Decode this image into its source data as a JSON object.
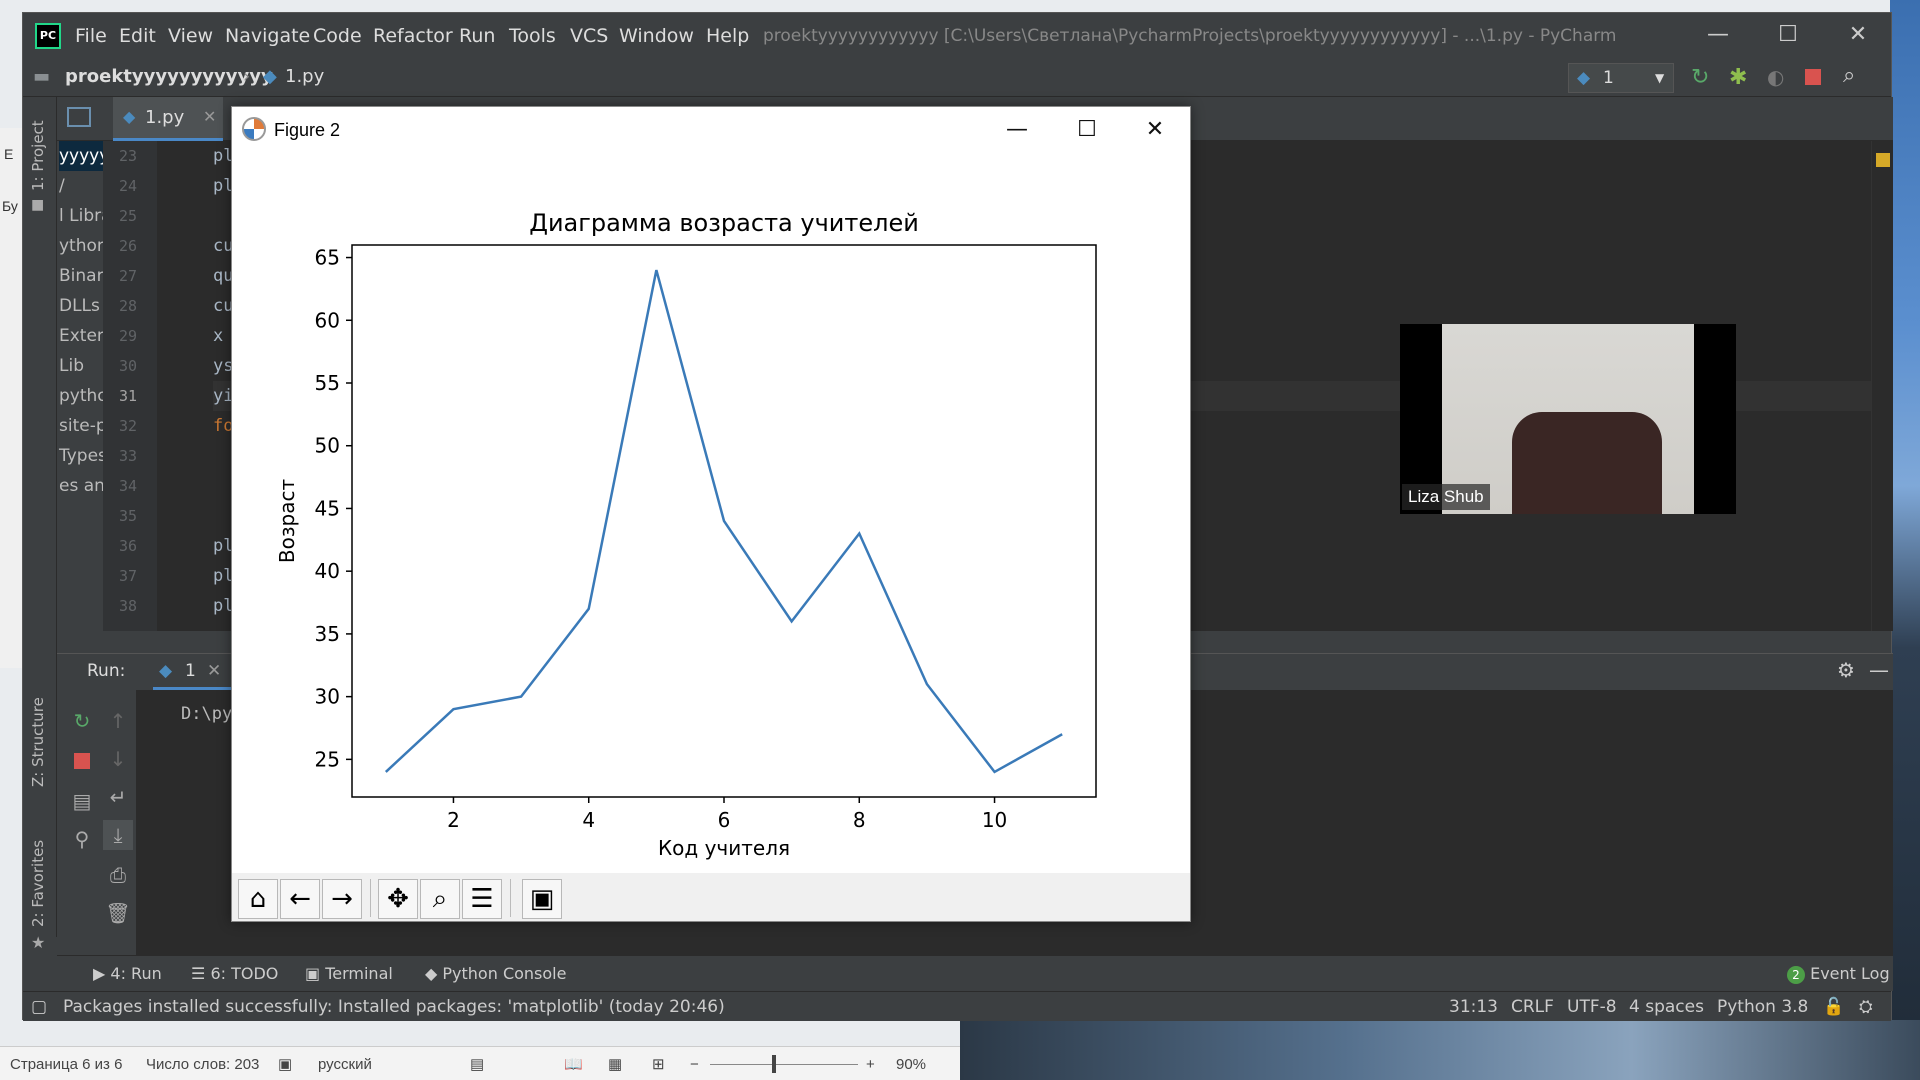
{
  "pycharm": {
    "menu": [
      "File",
      "Edit",
      "View",
      "Navigate",
      "Code",
      "Refactor",
      "Run",
      "Tools",
      "VCS",
      "Window",
      "Help"
    ],
    "window_title": "proektyyyyyyyyyyyy [C:\\Users\\Светлана\\PycharmProjects\\proektyyyyyyyyyyyy] - ...\\1.py - PyCharm",
    "breadcrumb_project": "proektyyyyyyyyyyyy",
    "breadcrumb_file": "1.py",
    "run_config": "1",
    "editor_tab": "1.py",
    "project_tab": "1: Project",
    "structure_tab": "Z: Structure",
    "favorites_tab": "2: Favorites",
    "project_items": [
      "yyyyy",
      "/",
      "l Libra",
      "ython",
      "Binary",
      "DLLs",
      "Extenc",
      "Lib",
      "pytho",
      "site-pa",
      "Types",
      "es and"
    ],
    "line_numbers": [
      "23",
      "24",
      "25",
      "26",
      "27",
      "28",
      "29",
      "30",
      "31",
      "32",
      "33",
      "34",
      "35",
      "36",
      "37",
      "38"
    ],
    "code_lines": [
      "plt.",
      "plt.",
      "",
      "cur",
      "quer",
      "cur.",
      "x =",
      "ysel",
      "yins",
      "for",
      "",
      "",
      "",
      "plt.",
      "plt.",
      "plt."
    ],
    "run_label": "Run:",
    "run_tab": "1",
    "console_text": "D:\\pyth",
    "bottom_tabs": [
      "4: Run",
      "6: TODO",
      "Terminal",
      "Python Console"
    ],
    "event_log": "Event Log",
    "event_log_count": "2",
    "status_message": "Packages installed successfully: Installed packages: 'matplotlib' (today 20:46)",
    "status_position": "31:13",
    "status_line_sep": "CRLF",
    "status_encoding": "UTF-8",
    "status_indent": "4 spaces",
    "status_interpreter": "Python 3.8"
  },
  "figure": {
    "window_title": "Figure 2"
  },
  "chart_data": {
    "type": "line",
    "title": "Диаграмма возраста учителей",
    "xlabel": "Код учителя",
    "ylabel": "Возраст",
    "x": [
      1,
      2,
      3,
      4,
      5,
      6,
      7,
      8,
      9,
      10,
      11
    ],
    "y": [
      24,
      29,
      30,
      37,
      64,
      44,
      36,
      43,
      31,
      24,
      27
    ],
    "xticks": [
      2,
      4,
      6,
      8,
      10
    ],
    "yticks": [
      25,
      30,
      35,
      40,
      45,
      50,
      55,
      60,
      65
    ],
    "xlim": [
      0.5,
      11.5
    ],
    "ylim": [
      22,
      66
    ],
    "line_color": "#3a7ab8",
    "grid": false
  },
  "webcam": {
    "name": "Liza Shub"
  },
  "word": {
    "page": "Страница 6 из 6",
    "words": "Число слов: 203",
    "language": "русский",
    "zoom": "90%",
    "left_letters": [
      "Е",
      "Бу"
    ]
  }
}
